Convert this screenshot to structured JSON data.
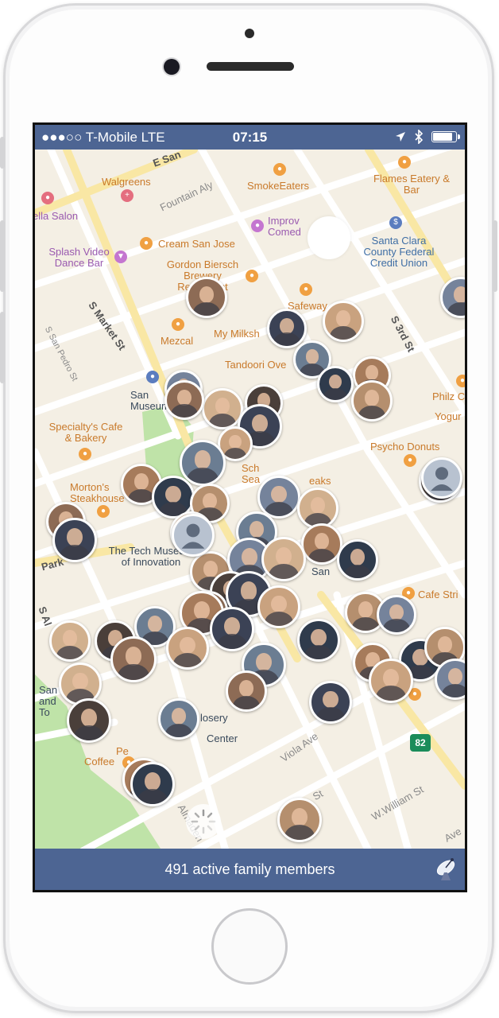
{
  "status_bar": {
    "carrier": "●●●○○ T-Mobile  LTE",
    "time": "07:15"
  },
  "map": {
    "streets": [
      "E San",
      "S Market St",
      "S San Pedro St",
      "S 3rd St",
      "Fountain Aly",
      "Viola Ave",
      "Almaden",
      "W.William St",
      "Park",
      "S Al",
      "St",
      "Ave"
    ],
    "places": [
      {
        "name": "Walgreens",
        "color": "pink"
      },
      {
        "name": "ella Salon",
        "color": "purple"
      },
      {
        "name": "SmokeEaters",
        "color": "orange"
      },
      {
        "name": "Flames Eatery & Bar",
        "color": "orange"
      },
      {
        "name": "Improv Comed",
        "color": "purple"
      },
      {
        "name": "Cream San Jose",
        "color": "orange"
      },
      {
        "name": "Splash Video Dance Bar",
        "color": "purple"
      },
      {
        "name": "Gordon Biersch Brewery Restaurant",
        "color": "orange"
      },
      {
        "name": "Santa Clara County Federal Credit Union",
        "color": "blue"
      },
      {
        "name": "Safeway",
        "color": "orange"
      },
      {
        "name": "Mezcal",
        "color": "orange"
      },
      {
        "name": "My Milksh",
        "color": "orange"
      },
      {
        "name": "Tandoori Ove",
        "color": "orange"
      },
      {
        "name": "San Museum",
        "color": "dark"
      },
      {
        "name": "Philz C",
        "color": "orange"
      },
      {
        "name": "Yogur",
        "color": "orange"
      },
      {
        "name": "Specialty's Cafe & Bakery",
        "color": "orange"
      },
      {
        "name": "Psycho Donuts",
        "color": "orange"
      },
      {
        "name": "Morton's Steakhouse",
        "color": "orange"
      },
      {
        "name": "Sch Sea",
        "color": "orange"
      },
      {
        "name": "eaks",
        "color": "orange"
      },
      {
        "name": "The Tech Museum of Innovation",
        "color": "dark"
      },
      {
        "name": "San",
        "color": "dark"
      },
      {
        "name": "Cafe Stri",
        "color": "orange"
      },
      {
        "name": "San and To",
        "color": "dark"
      },
      {
        "name": "Center",
        "color": "dark"
      },
      {
        "name": "losery",
        "color": "dark"
      },
      {
        "name": "Coffee",
        "color": "orange"
      },
      {
        "name": "Pe",
        "color": "orange"
      },
      {
        "name": "82",
        "color": "green"
      }
    ]
  },
  "footer": {
    "active_members_text": "491 active family members"
  },
  "icons": {
    "location": "location-arrow-icon",
    "bluetooth": "bluetooth-icon",
    "battery": "battery-icon",
    "dish": "satellite-dish-icon",
    "spinner": "loading-spinner-icon"
  },
  "colors": {
    "bar": "#4d6593",
    "map_bg": "#f4efe4",
    "road": "#ffffff",
    "major_road": "#f9e7a4",
    "park": "#bfe3a8"
  }
}
